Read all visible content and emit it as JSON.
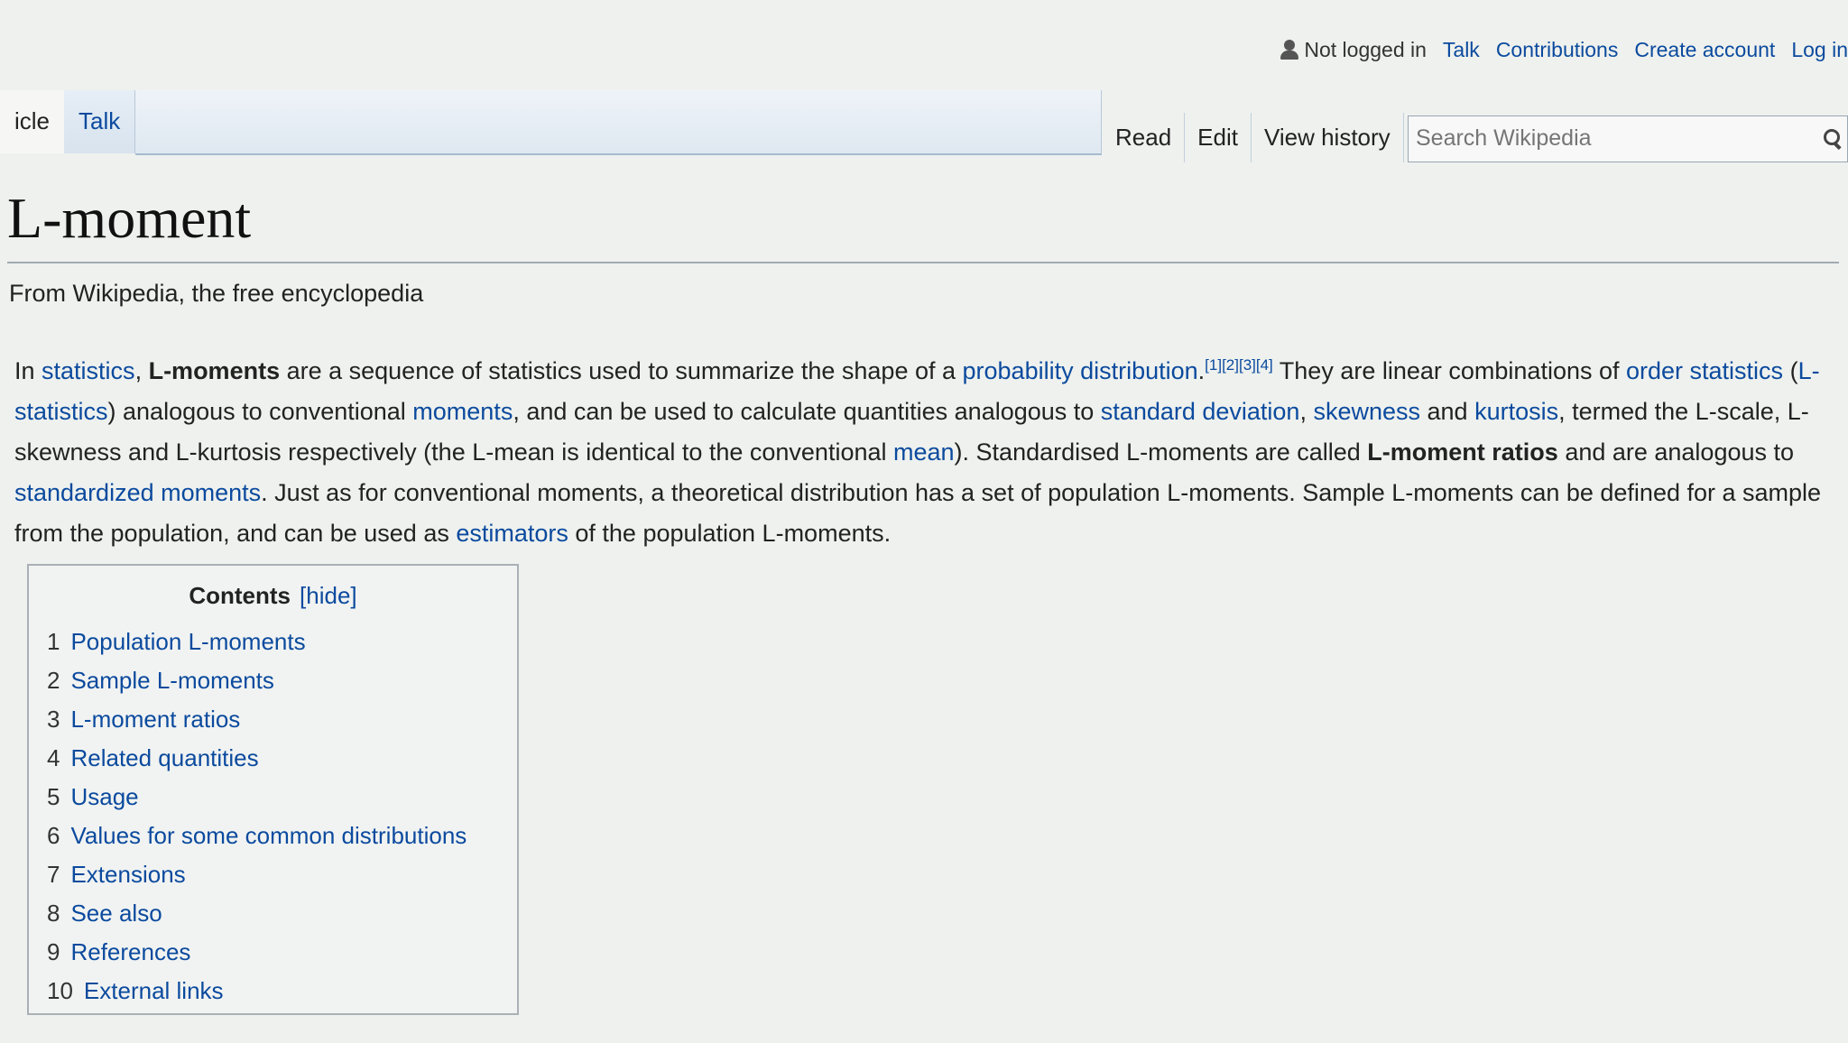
{
  "personal": {
    "user_status": "Not logged in",
    "talk": "Talk",
    "contributions": "Contributions",
    "create_account": "Create account",
    "log_in": "Log in"
  },
  "namespaces": {
    "article": "icle",
    "talk": "Talk"
  },
  "views": {
    "read": "Read",
    "edit": "Edit",
    "history": "View history"
  },
  "search": {
    "placeholder": "Search Wikipedia"
  },
  "article": {
    "title": "L-moment",
    "tagline": "From Wikipedia, the free encyclopedia",
    "lead": {
      "p1": "In ",
      "link_statistics": "statistics",
      "p2": ", ",
      "bold_lmoments": "L-moments",
      "p3": " are a sequence of statistics used to summarize the shape of a ",
      "link_probability": "probability distribution",
      "p4": ".",
      "refs": "[1][2][3][4]",
      "p5": " They are linear combinations of ",
      "link_order_statistics": "order statistics",
      "p6": " (",
      "link_lstatistics": "L-statistics",
      "p7": ") analogous to conventional ",
      "link_moments": "moments",
      "p8": ", and can be used to calculate quantities analogous to ",
      "link_std": "standard deviation",
      "p9": ", ",
      "link_skewness": "skewness",
      "p10": " and ",
      "link_kurtosis": "kurtosis",
      "p11": ", termed the L-scale, L-skewness and L-kurtosis respectively (the L-mean is identical to the conventional ",
      "link_mean": "mean",
      "p12": "). Standardised L-moments are called ",
      "bold_ratios": "L-moment ratios",
      "p13": " and are analogous to ",
      "link_standardized": "standardized moments",
      "p14": ". Just as for conventional moments, a theoretical distribution has a set of population L-moments. Sample L-moments can be defined for a sample from the population, and can be used as ",
      "link_estimators": "estimators",
      "p15": " of the population L-moments."
    }
  },
  "toc": {
    "title": "Contents",
    "toggle": "[hide]",
    "items": [
      {
        "num": "1",
        "label": "Population L-moments"
      },
      {
        "num": "2",
        "label": "Sample L-moments"
      },
      {
        "num": "3",
        "label": "L-moment ratios"
      },
      {
        "num": "4",
        "label": "Related quantities"
      },
      {
        "num": "5",
        "label": "Usage"
      },
      {
        "num": "6",
        "label": "Values for some common distributions"
      },
      {
        "num": "7",
        "label": "Extensions"
      },
      {
        "num": "8",
        "label": "See also"
      },
      {
        "num": "9",
        "label": "References"
      },
      {
        "num": "10",
        "label": "External links"
      }
    ]
  },
  "colors": {
    "link": "#0b4a9e",
    "background": "#eef1ee"
  },
  "icons": {
    "user": "user-icon",
    "search": "search-icon"
  }
}
